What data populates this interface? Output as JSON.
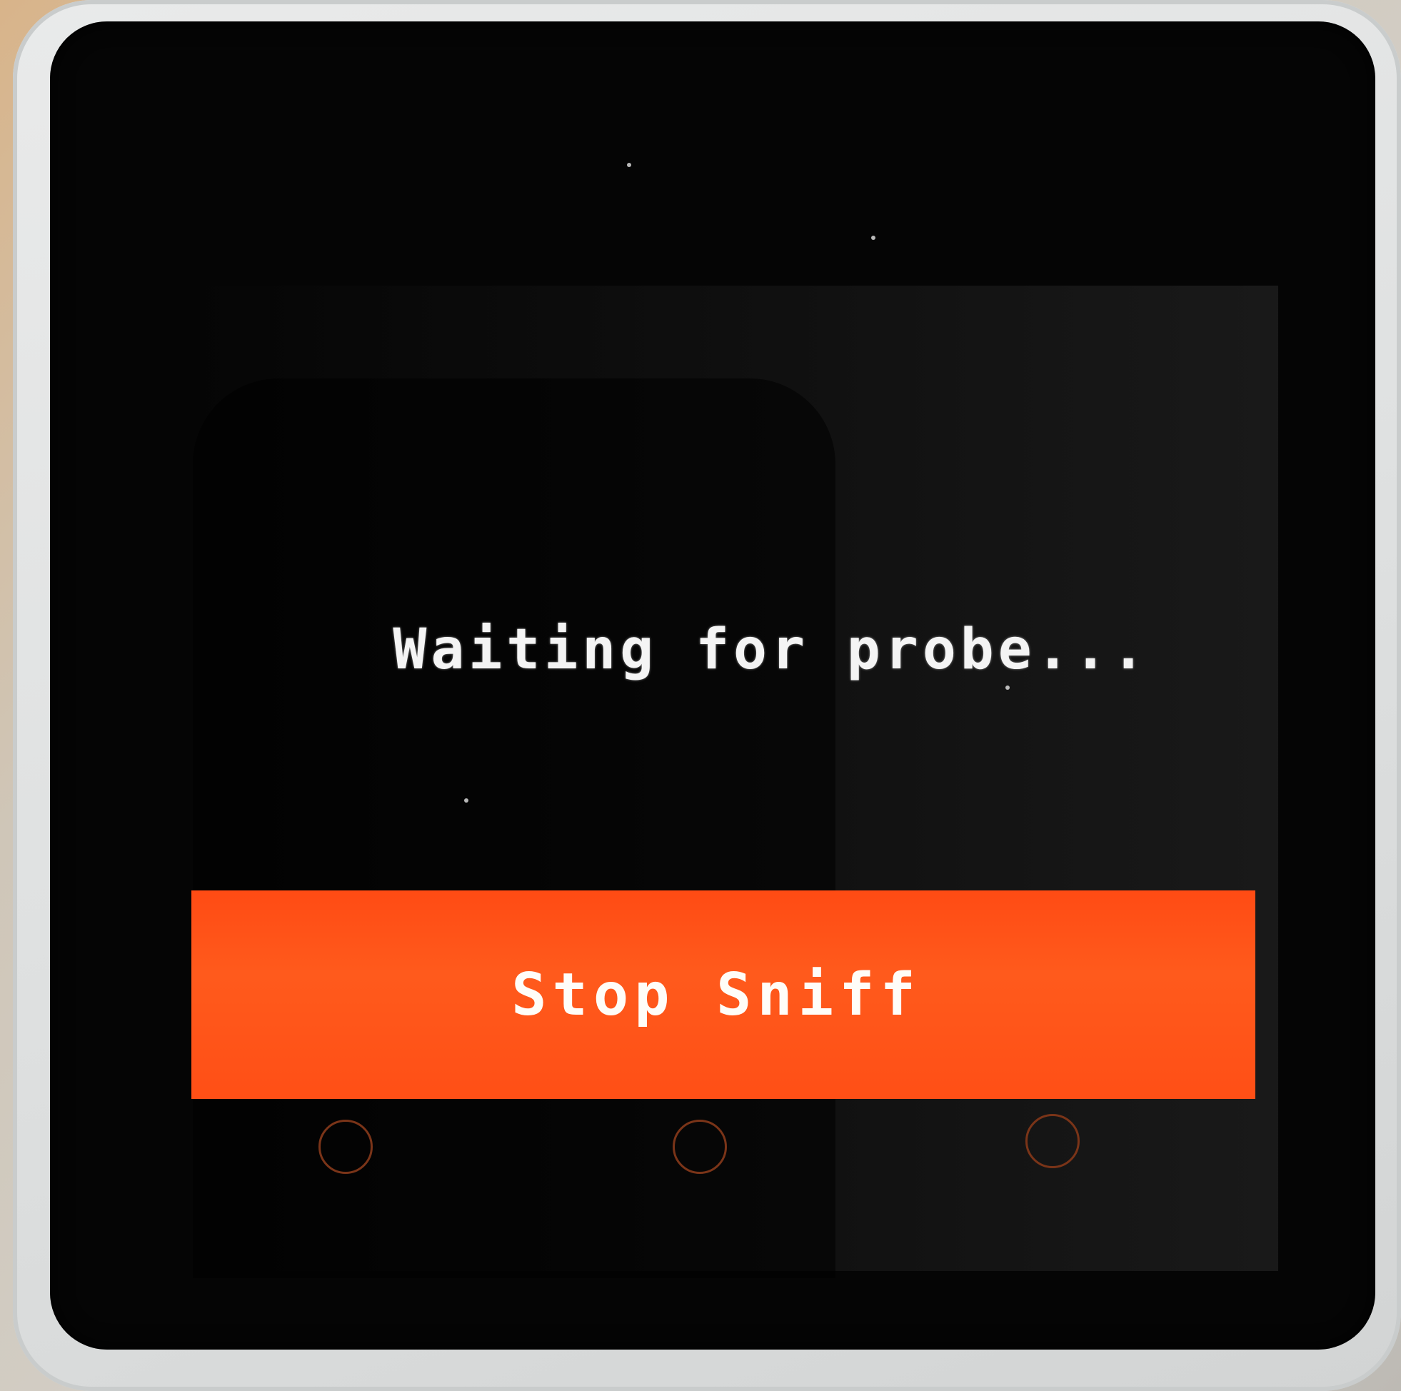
{
  "screen": {
    "status_text": "Waiting for probe...",
    "button_label": "Stop Sniff"
  },
  "colors": {
    "button_background": "#ff4f16",
    "screen_background": "#050505",
    "text": "#f4f4f4",
    "case": "#e2e3e3"
  },
  "touch_buttons": [
    {
      "icon": "circle-touch-icon"
    },
    {
      "icon": "circle-touch-icon"
    },
    {
      "icon": "circle-touch-icon"
    }
  ]
}
